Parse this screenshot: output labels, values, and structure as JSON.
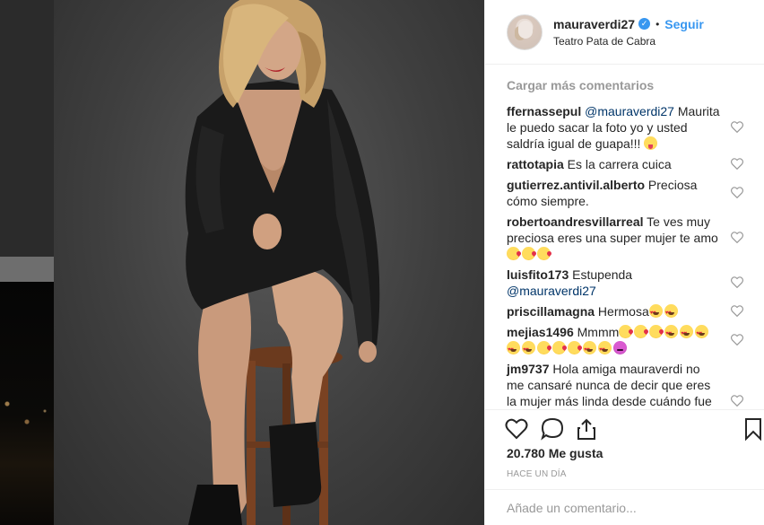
{
  "post": {
    "username": "mauraverdi27",
    "follow_label": "Seguir",
    "location": "Teatro Pata de Cabra",
    "load_more": "Cargar más comentarios",
    "likes": "20.780 Me gusta",
    "timestamp": "HACE UN DÍA",
    "add_comment_placeholder": "Añade un comentario..."
  },
  "comments": [
    {
      "user": "ffernassepul",
      "mention": "@mauraverdi27",
      "text": " Maurita le puedo sacar la foto yo y usted saldría igual de guapa!!! ",
      "emojis": [
        "tongue"
      ]
    },
    {
      "user": "rattotapia",
      "mention": "",
      "text": " Es la carrera cuica",
      "emojis": []
    },
    {
      "user": "gutierrez.antivil.alberto",
      "mention": "",
      "text": " Preciosa cómo siempre.",
      "emojis": []
    },
    {
      "user": "robertoandresvillarreal",
      "mention": "",
      "text": " Te ves muy preciosa eres una super mujer te amo ",
      "emojis": [
        "kiss",
        "kiss",
        "kiss"
      ]
    },
    {
      "user": "luisfito173",
      "mention": "",
      "text": " Estupenda ",
      "mention_after": "@mauraverdi27",
      "emojis": []
    },
    {
      "user": "priscillamagna",
      "mention": "",
      "text": " Hermosa",
      "emojis": [
        "heart-eyes",
        "heart-eyes"
      ]
    },
    {
      "user": "mejias1496",
      "mention": "",
      "text": " Mmmm",
      "emojis": [
        "kiss",
        "kiss",
        "kiss",
        "heart-eyes",
        "heart-eyes",
        "heart-eyes",
        "heart-eyes",
        "heart-eyes",
        "kiss",
        "kiss",
        "kiss",
        "heart-eyes",
        "heart-eyes",
        "devil"
      ]
    },
    {
      "user": "jm9737",
      "mention": "",
      "text": " Hola amiga mauraverdi no me cansaré nunca de decir que eres la mujer más linda desde cuándo fue la primera vez que entraste en la tv no",
      "emojis": []
    }
  ],
  "icons": {
    "verified": "verified-badge-icon",
    "like": "heart-outline-icon",
    "comment": "speech-bubble-icon",
    "share": "share-icon",
    "save": "bookmark-icon",
    "comment_like": "small-heart-icon"
  },
  "colors": {
    "accent": "#3897f0",
    "mention": "#003569",
    "muted": "#999999",
    "text": "#262626"
  }
}
